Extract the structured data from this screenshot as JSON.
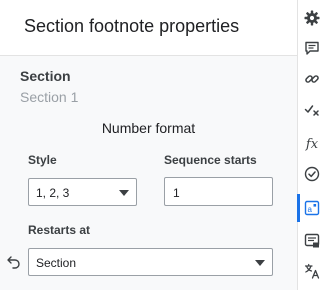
{
  "header": {
    "title": "Section footnote properties"
  },
  "section": {
    "label": "Section",
    "subtitle": "Section 1",
    "number_format_heading": "Number format",
    "style": {
      "label": "Style",
      "selected": "1, 2, 3"
    },
    "sequence_starts": {
      "label": "Sequence starts",
      "value": "1"
    },
    "restarts_at": {
      "label": "Restarts at",
      "selected": "Section"
    }
  },
  "side_rail": {
    "icons": [
      "gear-icon",
      "comment-icon",
      "link-icon",
      "spellcheck-icon",
      "function-icon",
      "check-circle-icon",
      "footnote-icon",
      "comments-list-icon",
      "translate-icon"
    ],
    "fx_label": "fx",
    "active_item": "footnote-icon",
    "accent_color": "#1a73e8"
  }
}
